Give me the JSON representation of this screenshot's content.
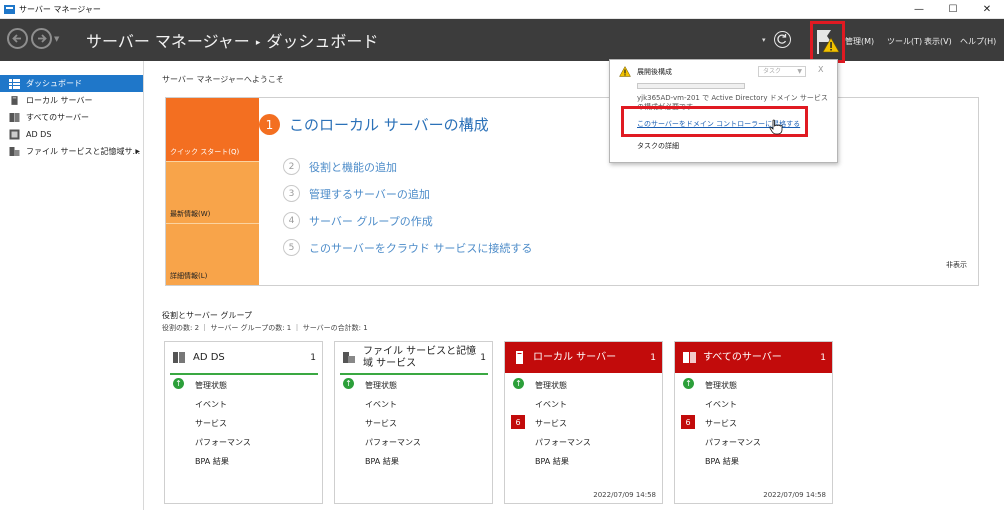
{
  "window": {
    "title": "サーバー マネージャー",
    "minimize": "—",
    "maximize": "☐",
    "close": "✕"
  },
  "header": {
    "breadcrumb_root": "サーバー マネージャー",
    "breadcrumb_sep": "▸",
    "breadcrumb_current": "ダッシュボード",
    "menus": [
      "管理(M)",
      "ツール(T)",
      "表示(V)",
      "ヘルプ(H)"
    ]
  },
  "sidebar": {
    "items": [
      {
        "label": "ダッシュボード",
        "icon": "dashboard-icon"
      },
      {
        "label": "ローカル サーバー",
        "icon": "server-icon"
      },
      {
        "label": "すべてのサーバー",
        "icon": "servers-icon"
      },
      {
        "label": "AD DS",
        "icon": "ad-ds-icon"
      },
      {
        "label": "ファイル サービスと記憶域サ...",
        "icon": "file-services-icon"
      }
    ]
  },
  "main": {
    "welcome": "サーバー マネージャーへようこそ",
    "quick_start": {
      "tabs": [
        "クイック スタート(Q)",
        "最新情報(W)",
        "詳細情報(L)"
      ],
      "primary": {
        "num": "1",
        "label": "このローカル サーバーの構成"
      },
      "steps": [
        {
          "num": "2",
          "label": "役割と機能の追加"
        },
        {
          "num": "3",
          "label": "管理するサーバーの追加"
        },
        {
          "num": "4",
          "label": "サーバー グループの作成"
        },
        {
          "num": "5",
          "label": "このサーバーをクラウド サービスに接続する"
        }
      ],
      "hide": "非表示"
    },
    "roles": {
      "heading": "役割とサーバー グループ",
      "summary": "役割の数: 2 ｜ サーバー グループの数: 1 ｜ サーバーの合計数: 1",
      "tiles": [
        {
          "name": "AD DS",
          "count": "1",
          "rows": [
            "管理状態",
            "イベント",
            "サービス",
            "パフォーマンス",
            "BPA 結果"
          ],
          "badge": "",
          "timestamp": ""
        },
        {
          "name": "ファイル サービスと記憶域 サービス",
          "count": "1",
          "rows": [
            "管理状態",
            "イベント",
            "サービス",
            "パフォーマンス",
            "BPA 結果"
          ],
          "badge": "",
          "timestamp": ""
        },
        {
          "name": "ローカル サーバー",
          "count": "1",
          "rows": [
            "管理状態",
            "イベント",
            "サービス",
            "パフォーマンス",
            "BPA 結果"
          ],
          "badge": "6",
          "timestamp": "2022/07/09 14:58"
        },
        {
          "name": "すべてのサーバー",
          "count": "1",
          "rows": [
            "管理状態",
            "イベント",
            "サービス",
            "パフォーマンス",
            "BPA 結果"
          ],
          "badge": "6",
          "timestamp": "2022/07/09 14:58"
        }
      ]
    }
  },
  "notification": {
    "title": "展開後構成",
    "task_label": "タスク",
    "close": "X",
    "description": "yjk365AD-vm-201 で Active Directory ドメイン サービスの構成が必要です",
    "link": "このサーバーをドメイン コントローラーに昇格する",
    "details": "タスクの詳細"
  },
  "colors": {
    "accent": "#f36f21",
    "alert": "#c20b0b",
    "highlight": "#e01a22",
    "link": "#1a5fb4",
    "ok": "#2c9f3a"
  }
}
